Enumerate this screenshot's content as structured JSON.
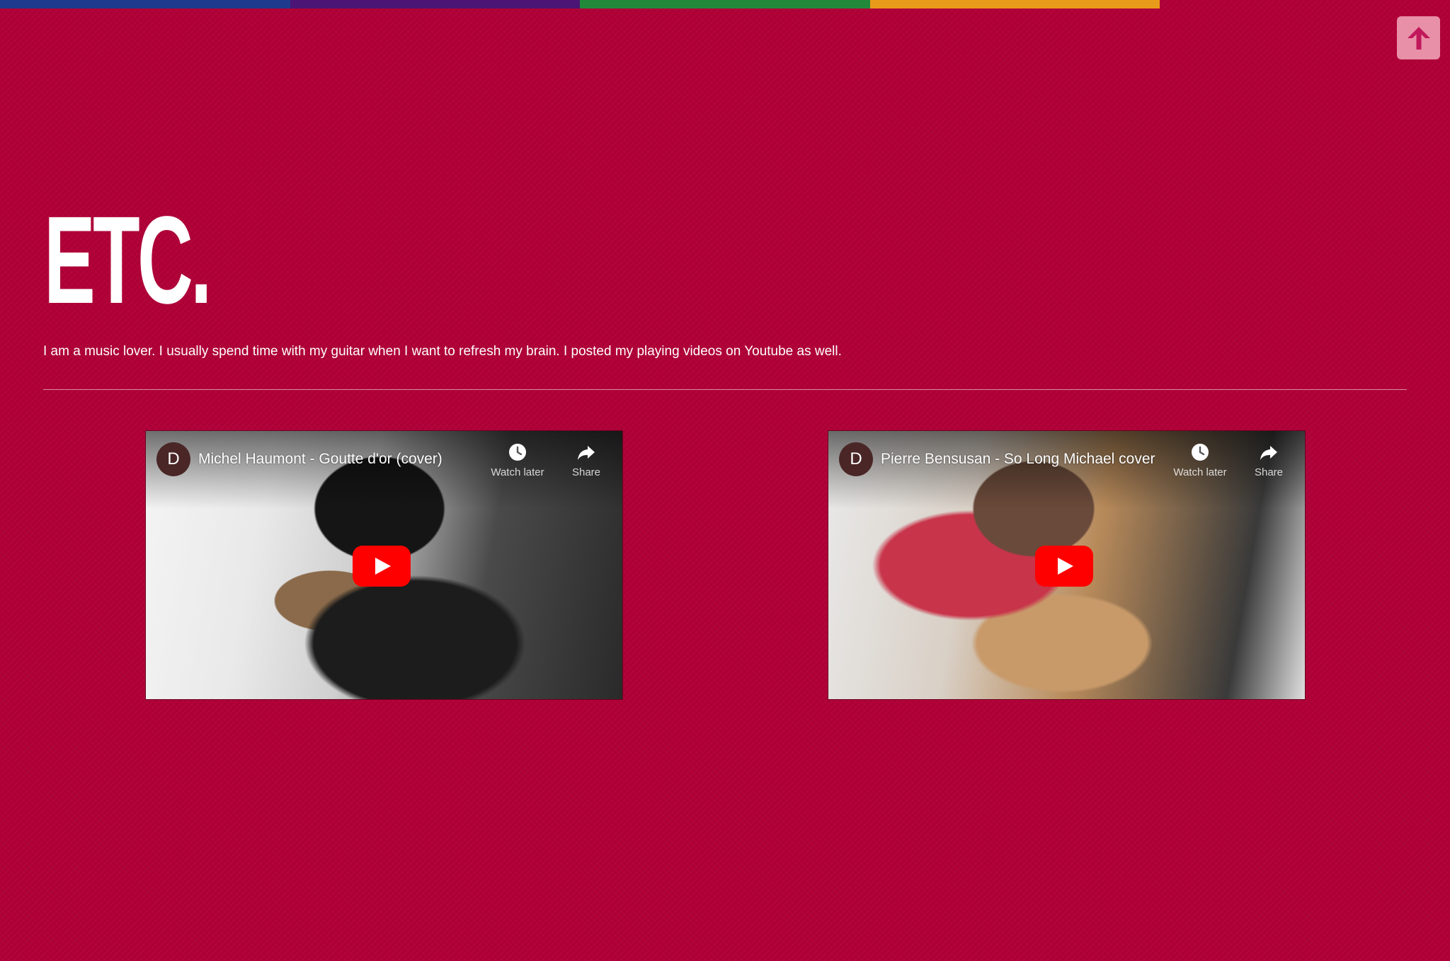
{
  "colors": {
    "background": "#b00037",
    "top_bar": [
      "#1e3a8c",
      "#4b1575",
      "#23893a",
      "#e89b1a"
    ],
    "back_to_top": "#e890a8",
    "back_to_top_arrow": "#c0185a",
    "play_button": "#ff0000"
  },
  "back_to_top": {
    "icon": "arrow-up-icon"
  },
  "page": {
    "title": "ETC.",
    "intro": "I am a music lover. I usually spend time with my guitar when I want to refresh my brain. I posted my playing videos on Youtube as well."
  },
  "videos": [
    {
      "channel_initial": "D",
      "title": "Michel Haumont - Goutte d'or (cover)",
      "watch_later_label": "Watch later",
      "share_label": "Share"
    },
    {
      "channel_initial": "D",
      "title": "Pierre Bensusan - So Long Michael cover",
      "watch_later_label": "Watch later",
      "share_label": "Share"
    }
  ]
}
